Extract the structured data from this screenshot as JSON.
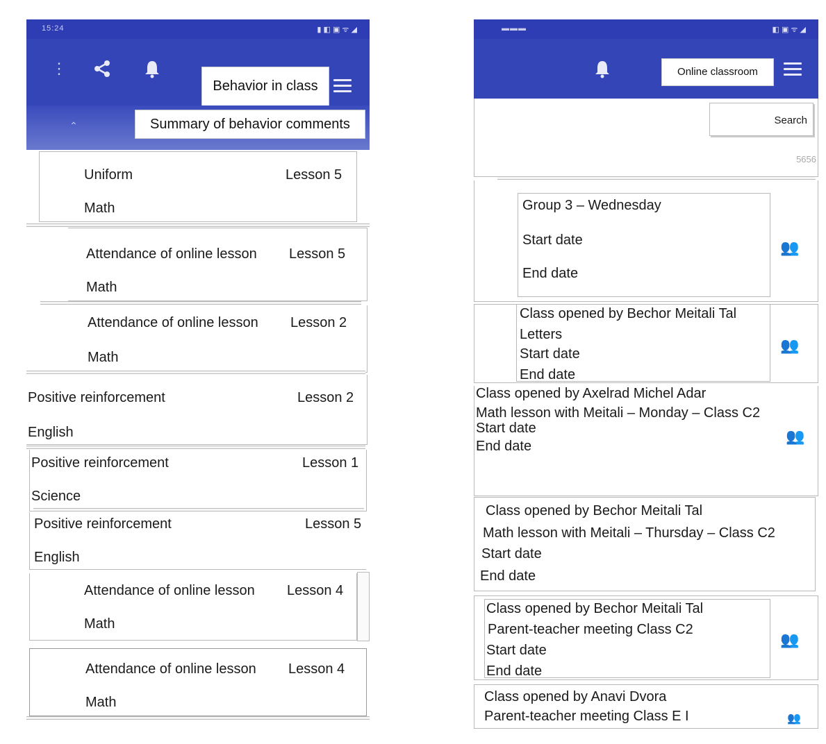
{
  "left": {
    "status_time": "15:24",
    "status_icons": "▮ ◧ ▣ ᯤ ◢",
    "menu_icon": "⋮",
    "share_icon": "share-icon",
    "bell_icon": "bell-icon",
    "title": "Behavior in class",
    "collapse_icon": "chevron-up-icon",
    "subtitle": "Summary of behavior comments",
    "items": [
      {
        "type": "Uniform",
        "lesson": "Lesson 5",
        "subject": "Math"
      },
      {
        "type": "Attendance of online lesson",
        "lesson": "Lesson 5",
        "subject": "Math"
      },
      {
        "type": "Attendance of online lesson",
        "lesson": "Lesson 2",
        "subject": "Math"
      },
      {
        "type": "Positive reinforcement",
        "lesson": "Lesson 2",
        "subject": "English"
      },
      {
        "type": "Positive reinforcement",
        "lesson": "Lesson 1",
        "subject": "Science"
      },
      {
        "type": "Positive reinforcement",
        "lesson": "Lesson 5",
        "subject": "English"
      },
      {
        "type": "Attendance of online lesson",
        "lesson": "Lesson 4",
        "subject": "Math"
      },
      {
        "type": "Attendance of online lesson",
        "lesson": "Lesson 4",
        "subject": "Math"
      }
    ]
  },
  "right": {
    "status_time": "▬▬▬",
    "status_icons": "◧ ▣ ᯤ ◢",
    "bell_icon": "bell-icon",
    "title": "Online classroom",
    "search_label": "Search",
    "extra_text": "5656",
    "classes": [
      {
        "line1": "Group 3 – Wednesday",
        "line2": "Start date",
        "line3": "End date"
      },
      {
        "line1": "Class opened by Bechor Meitali Tal",
        "line2": "Letters",
        "line3": "Start date",
        "line4": "End date"
      },
      {
        "line1": "Class opened by Axelrad Michel Adar",
        "line2": "Math lesson with Meitali – Monday – Class C2",
        "line3": "Start date",
        "line4": "End date"
      },
      {
        "line1": "Class opened by Bechor Meitali Tal",
        "line2": "Math lesson with Meitali – Thursday – Class C2",
        "line3": "Start date",
        "line4": "End date"
      },
      {
        "line1": "Class opened by Bechor Meitali Tal",
        "line2": "Parent-teacher meeting Class C2",
        "line3": "Start date",
        "line4": "End date"
      },
      {
        "line1": "Class opened by Anavi Dvora",
        "line2": "Parent-teacher meeting Class E I"
      }
    ],
    "group_icon": "people-group-icon"
  },
  "colors": {
    "appbar": "#3445b8",
    "statusbar": "#2f3db5"
  }
}
